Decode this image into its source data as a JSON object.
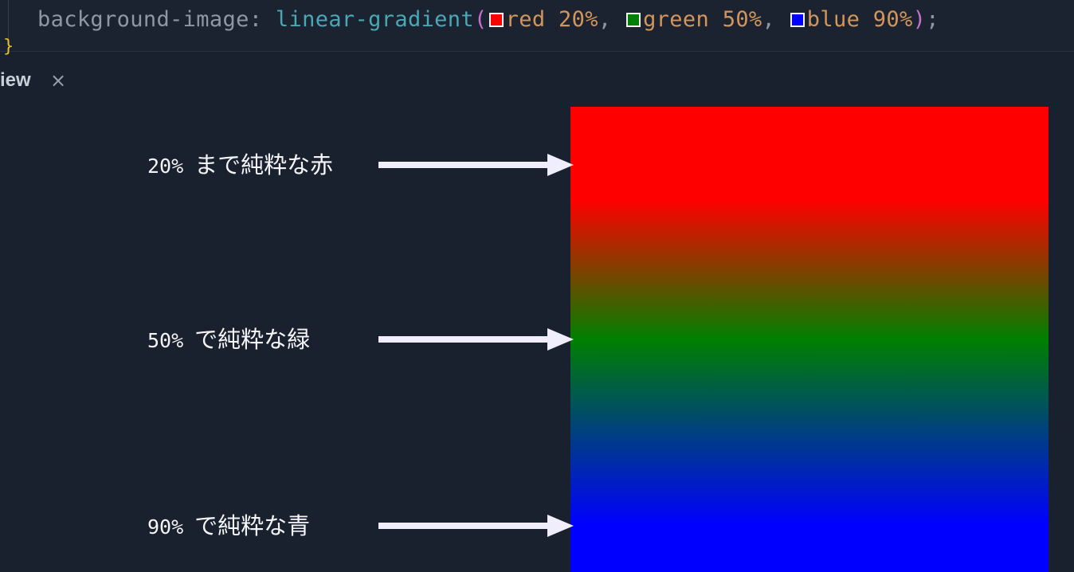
{
  "editor": {
    "property": "background-image",
    "colon": ":",
    "function_name": "linear-gradient",
    "open_paren": "(",
    "close_paren": ")",
    "semicolon": ";",
    "separator": ",",
    "stops": [
      {
        "color": "#ff0000",
        "text": "red 20%"
      },
      {
        "color": "#008000",
        "text": "green 50%"
      },
      {
        "color": "#0000ff",
        "text": "blue 90%"
      }
    ],
    "closing_brace": "}"
  },
  "preview": {
    "tab_label": "iew",
    "close_icon": "×",
    "gradient": {
      "direction": "to bottom",
      "stops": [
        {
          "color": "#ff0000",
          "position_percent": 20
        },
        {
          "color": "#008000",
          "position_percent": 50
        },
        {
          "color": "#0000ff",
          "position_percent": 90
        }
      ]
    },
    "annotations": [
      {
        "percent": "20%",
        "text": "まで純粋な赤"
      },
      {
        "percent": "50%",
        "text": "で純粋な緑"
      },
      {
        "percent": "90%",
        "text": "で純粋な青"
      }
    ],
    "arrow_icon": "right-arrow-icon"
  },
  "colors": {
    "background": "#18212d",
    "editor_background": "#1b2331",
    "property": "#8e98a4",
    "function": "#49a8b4",
    "paren": "#c96fcf",
    "value": "#d4955a",
    "annotation_text": "#f4f4f7",
    "arrow": "#f0eefc"
  }
}
